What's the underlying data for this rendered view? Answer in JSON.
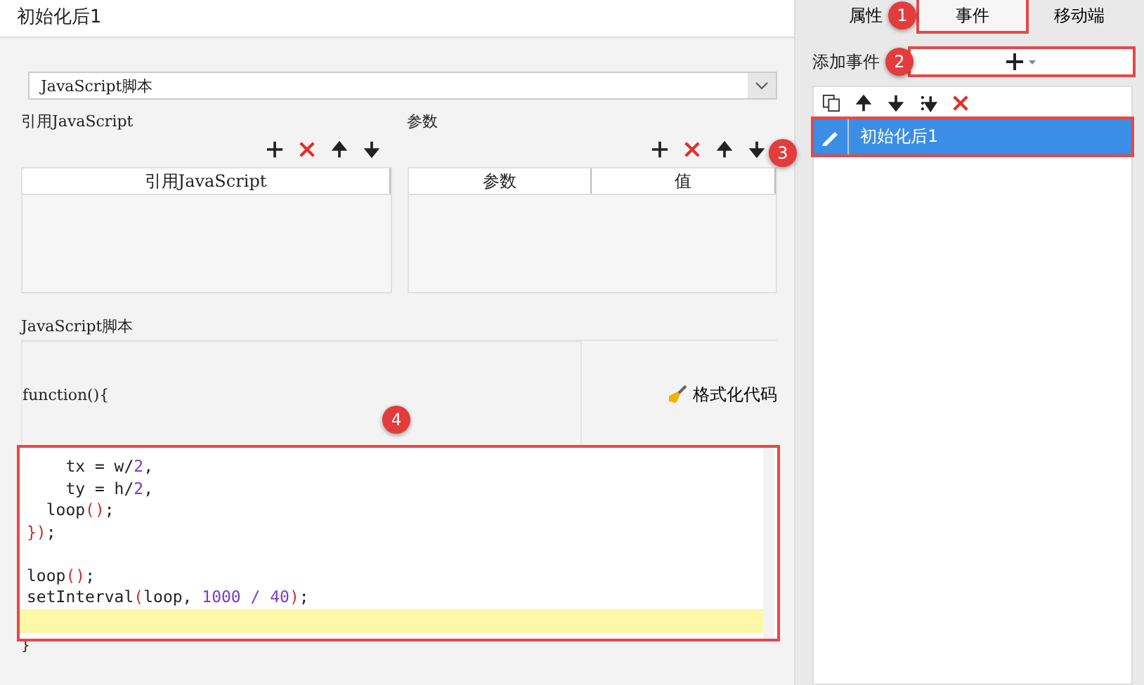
{
  "title": "初始化后1",
  "action_select": {
    "value": "JavaScript脚本"
  },
  "ref_section": {
    "label": "引用JavaScript",
    "toolbar": [
      {
        "kind": "add"
      },
      {
        "kind": "delete"
      },
      {
        "kind": "up"
      },
      {
        "kind": "down"
      }
    ],
    "columns": [
      "引用JavaScript"
    ]
  },
  "params_section": {
    "label": "参数",
    "toolbar": [
      {
        "kind": "add"
      },
      {
        "kind": "delete"
      },
      {
        "kind": "up"
      },
      {
        "kind": "down"
      }
    ],
    "columns": [
      "参数",
      "值"
    ],
    "callout": "3"
  },
  "script_section": {
    "label": "JavaScript脚本",
    "header": "function(){",
    "format_button": "格式化代码",
    "footer": "}",
    "editor": {
      "outlined": true,
      "callout": "4",
      "lines": [
        {
          "kind": "code",
          "tokens": [
            {
              "kind": "plain",
              "text": "    tx = w/"
            },
            {
              "kind": "num",
              "text": "2"
            },
            {
              "kind": "plain",
              "text": ","
            }
          ]
        },
        {
          "kind": "code",
          "tokens": [
            {
              "kind": "plain",
              "text": "    ty = h/"
            },
            {
              "kind": "num",
              "text": "2"
            },
            {
              "kind": "plain",
              "text": ","
            }
          ]
        },
        {
          "kind": "code",
          "tokens": [
            {
              "kind": "plain",
              "text": "  loop"
            },
            {
              "kind": "paren",
              "text": "()"
            },
            {
              "kind": "plain",
              "text": ";"
            }
          ]
        },
        {
          "kind": "code",
          "tokens": [
            {
              "kind": "paren",
              "text": "})"
            },
            {
              "kind": "plain",
              "text": ";"
            }
          ]
        },
        {
          "kind": "blank"
        },
        {
          "kind": "code",
          "tokens": [
            {
              "kind": "plain",
              "text": "loop"
            },
            {
              "kind": "paren",
              "text": "()"
            },
            {
              "kind": "plain",
              "text": ";"
            }
          ]
        },
        {
          "kind": "code",
          "tokens": [
            {
              "kind": "plain",
              "text": "setInterval"
            },
            {
              "kind": "paren",
              "text": "("
            },
            {
              "kind": "plain",
              "text": "loop, "
            },
            {
              "kind": "num",
              "text": "1000 / 40"
            },
            {
              "kind": "paren",
              "text": ")"
            },
            {
              "kind": "plain",
              "text": ";"
            }
          ]
        },
        {
          "kind": "current"
        }
      ]
    }
  },
  "right_panel": {
    "tabs": [
      {
        "label": "属性",
        "selected": false,
        "outlined": false,
        "callout": "1"
      },
      {
        "label": "事件",
        "selected": true,
        "outlined": true
      },
      {
        "label": "移动端",
        "selected": false,
        "outlined": false
      }
    ],
    "add_event": {
      "label": "添加事件",
      "outlined": true,
      "callout": "2"
    },
    "toolbar": [
      {
        "kind": "copy"
      },
      {
        "kind": "up"
      },
      {
        "kind": "down"
      },
      {
        "kind": "bottom"
      },
      {
        "kind": "delete"
      }
    ],
    "events": [
      {
        "label": "初始化后1",
        "selected": true,
        "outlined": true
      }
    ]
  }
}
